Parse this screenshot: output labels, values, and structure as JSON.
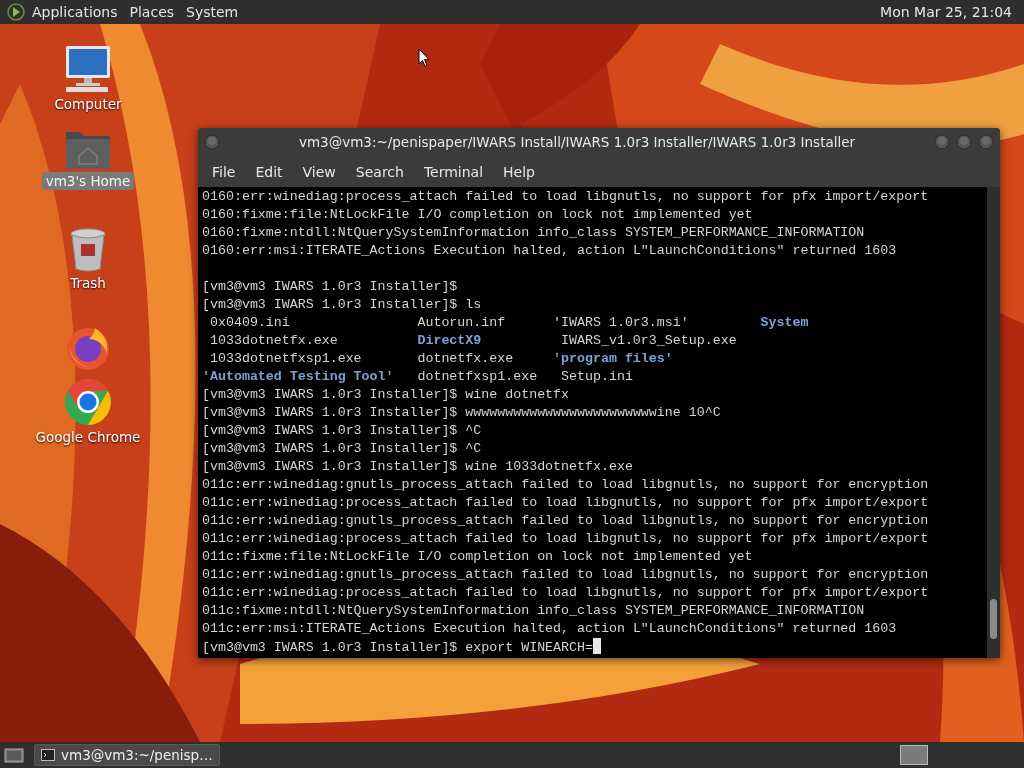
{
  "top_panel": {
    "menus": [
      "Applications",
      "Places",
      "System"
    ],
    "clock": "Mon Mar 25, 21:04"
  },
  "desktop_icons": [
    {
      "kind": "computer",
      "label": "Computer",
      "selected": false
    },
    {
      "kind": "home",
      "label": "vm3's Home",
      "selected": true
    },
    {
      "kind": "trash",
      "label": "Trash",
      "selected": false
    },
    {
      "kind": "firefox",
      "selected": false
    },
    {
      "kind": "chrome",
      "label": "Google Chrome",
      "selected": false
    }
  ],
  "terminal": {
    "title": "vm3@vm3:~/penispaper/IWARS Install/IWARS 1.0r3 Installer/IWARS 1.0r3 Installer",
    "menus": [
      "File",
      "Edit",
      "View",
      "Search",
      "Terminal",
      "Help"
    ],
    "lines": [
      {
        "kind": "text",
        "text": "0160:err:winediag:process_attach failed to load libgnutls, no support for pfx import/export"
      },
      {
        "kind": "text",
        "text": "0160:fixme:file:NtLockFile I/O completion on lock not implemented yet"
      },
      {
        "kind": "text",
        "text": "0160:fixme:ntdll:NtQuerySystemInformation info_class SYSTEM_PERFORMANCE_INFORMATION"
      },
      {
        "kind": "text",
        "text": "0160:err:msi:ITERATE_Actions Execution halted, action L\"LaunchConditions\" returned 1603"
      },
      {
        "kind": "blank"
      },
      {
        "kind": "text",
        "text": "[vm3@vm3 IWARS 1.0r3 Installer]$"
      },
      {
        "kind": "text",
        "text": "[vm3@vm3 IWARS 1.0r3 Installer]$ ls"
      },
      {
        "kind": "ls",
        "cells": [
          {
            "text": " 0x0409.ini",
            "kind": "file"
          },
          {
            "text": "Autorun.inf",
            "kind": "file"
          },
          {
            "text": "'IWARS 1.0r3.msi'",
            "kind": "file"
          },
          {
            "text": "System",
            "kind": "dir"
          }
        ]
      },
      {
        "kind": "ls",
        "cells": [
          {
            "text": " 1033dotnetfx.exe",
            "kind": "file"
          },
          {
            "text": "DirectX9",
            "kind": "dir"
          },
          {
            "text": " IWARS_v1.0r3_Setup.exe",
            "kind": "file"
          }
        ]
      },
      {
        "kind": "ls",
        "cells": [
          {
            "text": " 1033dotnetfxsp1.exe",
            "kind": "file"
          },
          {
            "text": "dotnetfx.exe",
            "kind": "file"
          },
          {
            "text": "'program files'",
            "kind": "dir"
          }
        ]
      },
      {
        "kind": "ls",
        "cells": [
          {
            "text": "'Automated Testing Tool'",
            "kind": "dir"
          },
          {
            "text": "dotnetfxsp1.exe",
            "kind": "file"
          },
          {
            "text": " Setup.ini",
            "kind": "file"
          }
        ]
      },
      {
        "kind": "text",
        "text": "[vm3@vm3 IWARS 1.0r3 Installer]$ wine dotnetfx"
      },
      {
        "kind": "text",
        "text": "[vm3@vm3 IWARS 1.0r3 Installer]$ wwwwwwwwwwwwwwwwwwwwwwwwine 10^C"
      },
      {
        "kind": "text",
        "text": "[vm3@vm3 IWARS 1.0r3 Installer]$ ^C"
      },
      {
        "kind": "text",
        "text": "[vm3@vm3 IWARS 1.0r3 Installer]$ ^C"
      },
      {
        "kind": "text",
        "text": "[vm3@vm3 IWARS 1.0r3 Installer]$ wine 1033dotnetfx.exe"
      },
      {
        "kind": "text",
        "text": "011c:err:winediag:gnutls_process_attach failed to load libgnutls, no support for encryption"
      },
      {
        "kind": "text",
        "text": "011c:err:winediag:process_attach failed to load libgnutls, no support for pfx import/export"
      },
      {
        "kind": "text",
        "text": "011c:err:winediag:gnutls_process_attach failed to load libgnutls, no support for encryption"
      },
      {
        "kind": "text",
        "text": "011c:err:winediag:process_attach failed to load libgnutls, no support for pfx import/export"
      },
      {
        "kind": "text",
        "text": "011c:fixme:file:NtLockFile I/O completion on lock not implemented yet"
      },
      {
        "kind": "text",
        "text": "011c:err:winediag:gnutls_process_attach failed to load libgnutls, no support for encryption"
      },
      {
        "kind": "text",
        "text": "011c:err:winediag:process_attach failed to load libgnutls, no support for pfx import/export"
      },
      {
        "kind": "text",
        "text": "011c:fixme:ntdll:NtQuerySystemInformation info_class SYSTEM_PERFORMANCE_INFORMATION"
      },
      {
        "kind": "text",
        "text": "011c:err:msi:ITERATE_Actions Execution halted, action L\"LaunchConditions\" returned 1603"
      },
      {
        "kind": "text",
        "text": "[vm3@vm3 IWARS 1.0r3 Installer]$ export WINEARCH="
      }
    ],
    "cursor_visible": true
  },
  "taskbar": {
    "tasks": [
      {
        "label": "vm3@vm3:~/penisp…",
        "selected": true
      }
    ]
  }
}
